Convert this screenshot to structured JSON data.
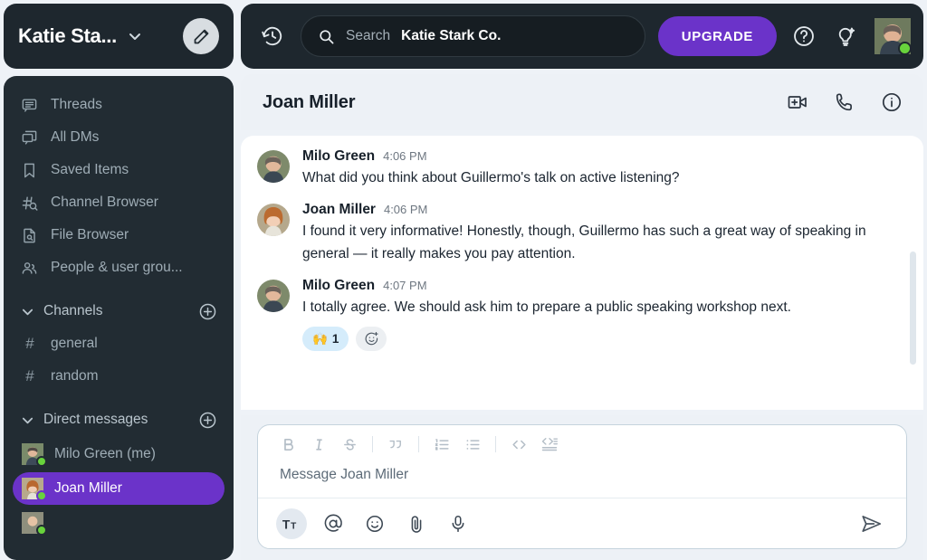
{
  "workspace": {
    "name": "Katie Sta...",
    "caret_icon": "chevron-down-icon",
    "edit_icon": "pencil-icon"
  },
  "sidebar": {
    "nav": [
      {
        "label": "Threads",
        "icon": "threads-icon"
      },
      {
        "label": "All DMs",
        "icon": "all-dms-icon"
      },
      {
        "label": "Saved Items",
        "icon": "bookmark-icon"
      },
      {
        "label": "Channel Browser",
        "icon": "channel-browser-icon"
      },
      {
        "label": "File Browser",
        "icon": "file-browser-icon"
      },
      {
        "label": "People & user grou...",
        "icon": "people-icon"
      }
    ],
    "channels_section": {
      "label": "Channels",
      "add_icon": "plus-circle-icon"
    },
    "channels": [
      {
        "label": "general"
      },
      {
        "label": "random"
      }
    ],
    "dms_section": {
      "label": "Direct messages",
      "add_icon": "plus-circle-icon"
    },
    "dms": [
      {
        "label": "Milo Green (me)",
        "status": "online",
        "selected": false
      },
      {
        "label": "Joan Miller",
        "status": "online",
        "selected": true
      }
    ]
  },
  "topbar": {
    "history_icon": "history-icon",
    "search": {
      "icon": "search-icon",
      "placeholder": "Search",
      "workspace": "Katie Stark Co."
    },
    "upgrade_label": "UPGRADE",
    "help_icon": "help-circle-icon",
    "ideas_icon": "lightbulb-sparkle-icon",
    "avatar": {
      "name": "avatar",
      "status": "online"
    }
  },
  "conversation": {
    "title": "Joan Miller",
    "actions": [
      {
        "icon": "video-add-icon",
        "name": "start-video-call-button"
      },
      {
        "icon": "phone-icon",
        "name": "start-call-button"
      },
      {
        "icon": "info-icon",
        "name": "conversation-info-button"
      }
    ],
    "messages": [
      {
        "author": "Milo Green",
        "time": "4:06 PM",
        "text": "What did you think about Guillermo's talk on active listening?",
        "avatar": "milo",
        "reactions": []
      },
      {
        "author": "Joan Miller",
        "time": "4:06 PM",
        "text": "I found it very informative! Honestly, though, Guillermo has such a great way of speaking in general — it really makes you pay attention.",
        "avatar": "joan",
        "reactions": []
      },
      {
        "author": "Milo Green",
        "time": "4:07 PM",
        "text": "I totally agree. We should ask him to prepare a public speaking workshop next.",
        "avatar": "milo",
        "reactions": [
          {
            "emoji": "🙌",
            "count": "1"
          }
        ]
      }
    ]
  },
  "composer": {
    "placeholder": "Message Joan Miller",
    "format_buttons": [
      {
        "name": "bold-button",
        "label": "B"
      },
      {
        "name": "italic-button",
        "label": "I"
      },
      {
        "name": "strikethrough-button",
        "label": "S"
      },
      {
        "name": "blockquote-button",
        "label": "\"\""
      },
      {
        "name": "ordered-list-button",
        "label": "1."
      },
      {
        "name": "bullet-list-button",
        "label": "•"
      },
      {
        "name": "code-button",
        "label": "<>"
      },
      {
        "name": "code-block-button",
        "label": "<>≡"
      }
    ],
    "action_buttons": [
      {
        "name": "formatting-toggle-button",
        "icon": "text-format-icon",
        "active": true
      },
      {
        "name": "mention-button",
        "icon": "at-icon",
        "active": false
      },
      {
        "name": "emoji-button",
        "icon": "smiley-icon",
        "active": false
      },
      {
        "name": "attach-button",
        "icon": "paperclip-icon",
        "active": false
      },
      {
        "name": "record-audio-button",
        "icon": "microphone-icon",
        "active": false
      }
    ],
    "send_icon": "send-icon"
  },
  "colors": {
    "accent_purple": "#6b33c9",
    "sidebar_dark": "#222c33",
    "header_dark": "#1e272e",
    "online_green": "#68d33c",
    "reaction_blue": "#d5ecfb"
  }
}
